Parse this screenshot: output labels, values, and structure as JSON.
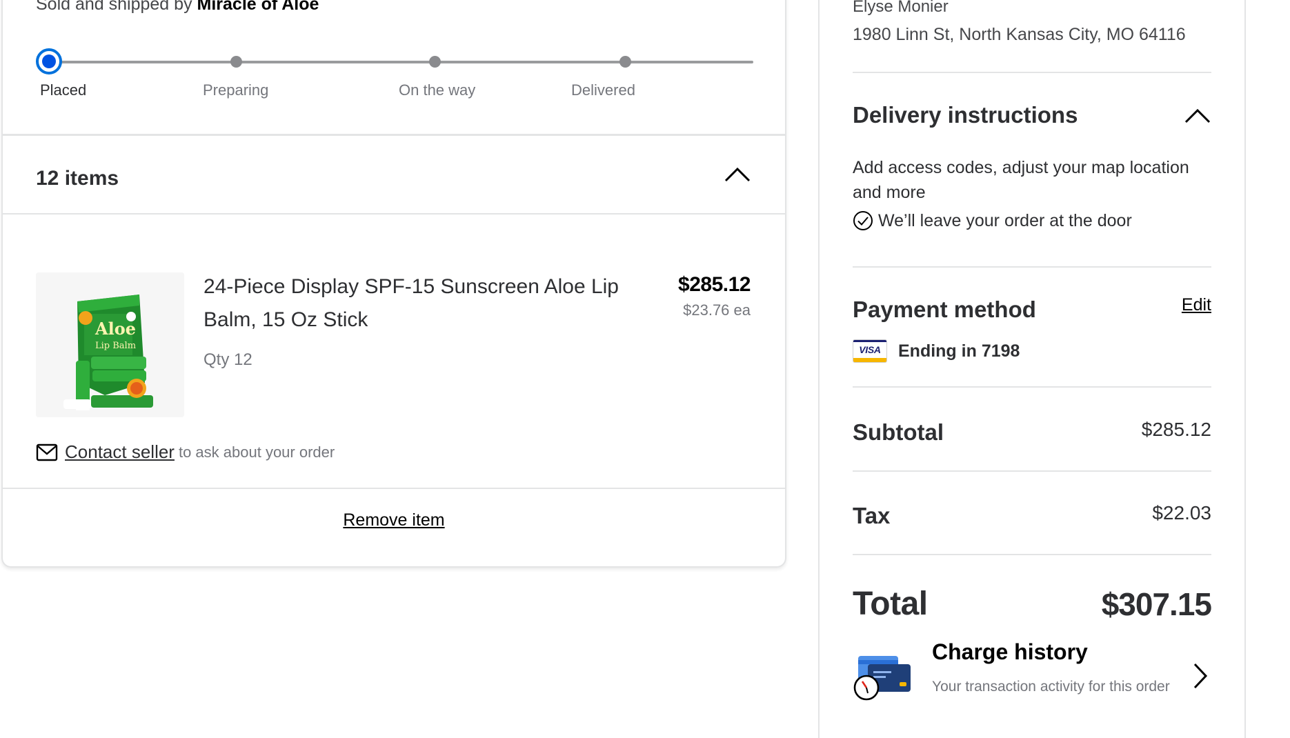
{
  "shipment": {
    "sold_prefix": "Sold and shipped by",
    "seller": "Miracle of Aloe"
  },
  "tracker": {
    "steps": [
      {
        "label": "Placed",
        "active": true
      },
      {
        "label": "Preparing",
        "active": false
      },
      {
        "label": "On the way",
        "active": false
      },
      {
        "label": "Delivered",
        "active": false
      }
    ],
    "accent_color": "#0053e2"
  },
  "items": {
    "header": "12 items",
    "product": {
      "name": "24-Piece Display SPF-15 Sunscreen Aloe Lip Balm, 15 Oz Stick",
      "qty": "Qty 12",
      "price": "$285.12",
      "price_each": "$23.76 ea",
      "image_text": [
        "Aloe",
        "Lip Balm"
      ]
    },
    "contact_link": "Contact seller",
    "contact_rest": "to ask about your order",
    "remove_label": "Remove item"
  },
  "address": {
    "name": "Elyse Monier",
    "line": "1980 Linn St, North Kansas City, MO 64116"
  },
  "delivery": {
    "title": "Delivery instructions",
    "description": "Add access codes, adjust your map location and more",
    "leave_note": "We’ll leave your order at the door"
  },
  "payment": {
    "title": "Payment method",
    "edit_label": "Edit",
    "card_brand": "VISA",
    "card_text": "Ending in 7198"
  },
  "summary": {
    "subtotal_label": "Subtotal",
    "subtotal_value": "$285.12",
    "tax_label": "Tax",
    "tax_value": "$22.03",
    "total_label": "Total",
    "total_value": "$307.15"
  },
  "charge_history": {
    "title": "Charge history",
    "subtitle": "Your transaction activity for this order"
  }
}
